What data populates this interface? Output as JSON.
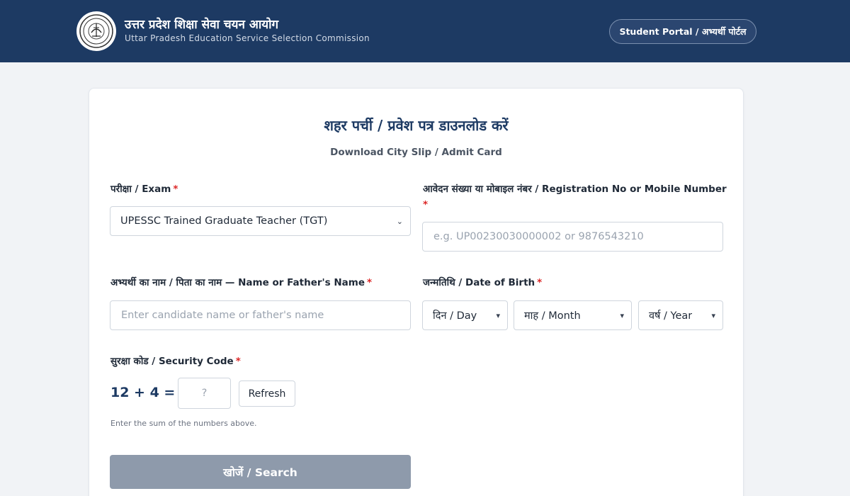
{
  "header": {
    "org_name_hindi": "उत्तर प्रदेश शिक्षा सेवा चयन आयोग",
    "org_name_english": "Uttar Pradesh Education Service Selection Commission",
    "portal_button": "Student Portal / अभ्यर्थी पोर्टल"
  },
  "form": {
    "title": "शहर पर्ची / प्रवेश पत्र डाउनलोड करें",
    "subtitle": "Download City Slip / Admit Card",
    "required_marker": "*",
    "exam": {
      "label": "परीक्षा / Exam",
      "selected": "UPESSC Trained Graduate Teacher (TGT)"
    },
    "registration": {
      "label": "आवेदन संख्या या मोबाइल नंबर / Registration No or Mobile Number",
      "placeholder": "e.g. UP00230030000002 or 9876543210"
    },
    "name": {
      "label": "अभ्यर्थी का नाम / पिता का नाम — Name or Father's Name",
      "placeholder": "Enter candidate name or father's name"
    },
    "dob": {
      "label": "जन्मतिथि / Date of Birth",
      "day": "दिन / Day",
      "month": "माह / Month",
      "year": "वर्ष / Year"
    },
    "security": {
      "label": "सुरक्षा कोड / Security Code",
      "question": "12 + 4 =",
      "placeholder": "?",
      "refresh": "Refresh",
      "hint": "Enter the sum of the numbers above."
    },
    "search_button": "खोजें / Search"
  }
}
